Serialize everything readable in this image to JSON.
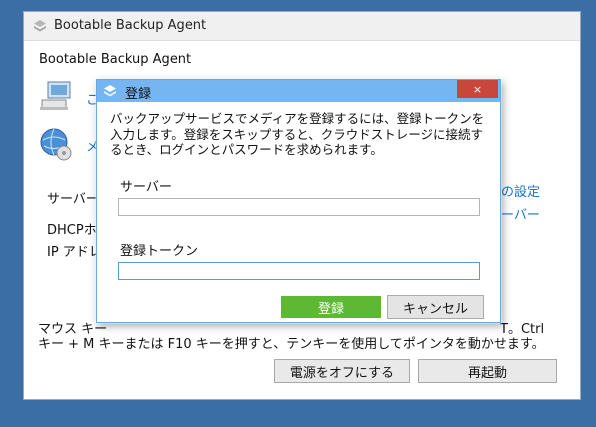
{
  "window": {
    "title": "Bootable Backup Agent",
    "heading": "Bootable Backup Agent"
  },
  "background": {
    "menu_items": [
      {
        "label": "こ",
        "icon": "computer-icon"
      },
      {
        "label": "メ",
        "icon": "disc-globe-icon"
      }
    ],
    "server_label": "サーバー",
    "dhcp_text": "DHCPホ",
    "ip_text": "IP アドレ",
    "right_link_1": "の設定",
    "right_link_2": "ーバー",
    "mouse_text_line1_start": "マウス キー",
    "mouse_text_line1_end": "T。Ctrl",
    "mouse_text_line2": "キー + M キーまたは F10 キーを押すと、テンキーを使用してポインタを動かせます。",
    "power_off_button": "電源をオフにする",
    "restart_button": "再起動"
  },
  "dialog": {
    "title": "登録",
    "close_label": "×",
    "description": "バックアップサービスでメディアを登録するには、登録トークンを入力します。登録をスキップすると、クラウドストレージに接続するとき、ログインとパスワードを求められます。",
    "server_label": "サーバー",
    "server_value": "",
    "token_label": "登録トークン",
    "token_value": "",
    "register_button": "登録",
    "cancel_button": "キャンセル"
  },
  "colors": {
    "desktop": "#3a6ea5",
    "dialog_titlebar": "#75b5f2",
    "close_button": "#c9463d",
    "register_button": "#5fb833",
    "link": "#1a73c7"
  }
}
